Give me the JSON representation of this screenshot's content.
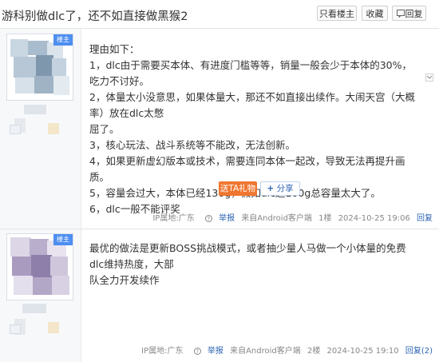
{
  "header": {
    "title": "游科别做dlc了，还不如直接做黑猴2",
    "only_op_label": "只看楼主",
    "favorite_label": "收藏",
    "reply_label": "回复"
  },
  "post1": {
    "op_badge": "楼主",
    "lines": [
      "理由如下：",
      "1，dlc由于需要买本体、有进度门槛等等，销量一般会少于本体的30%，吃力不讨好。",
      "2，体量太小没意思，如果体量大，那还不如直接出续作。大闹天宫（大概率）放在dlc太憋",
      "屈了。",
      "3，核心玩法、战斗系统等不能改，无法创新。",
      "4，如果更新虚幻版本或技术，需要连同本体一起改，导致无法再提升画质。",
      "5，容量会过大，本体已经130g，假如dlc超100g总容量太大了。",
      "6，dlc一般不能评奖"
    ],
    "gift_label": "送TA礼物",
    "share_label": "分享",
    "meta": {
      "ip": "IP属地:广东",
      "report": "举报",
      "source": "来自Android客户端",
      "floor": "1楼",
      "time": "2024-10-25 19:06",
      "reply": "回复"
    }
  },
  "post2": {
    "op_badge": "楼主",
    "lines": [
      "最优的做法是更新BOSS挑战模式，或者抽少量人马做一个小体量的免费dlc维持热度，大部",
      "队全力开发续作"
    ],
    "meta": {
      "ip": "IP属地:广东",
      "report": "举报",
      "source": "来自Android客户端",
      "floor": "2楼",
      "time": "2024-10-25 19:10",
      "reply": "回复(2)"
    }
  },
  "colors": {
    "badge_blue": "#4d8ef0",
    "gift_orange": "#f0762f",
    "link_blue": "#2d64b3"
  }
}
